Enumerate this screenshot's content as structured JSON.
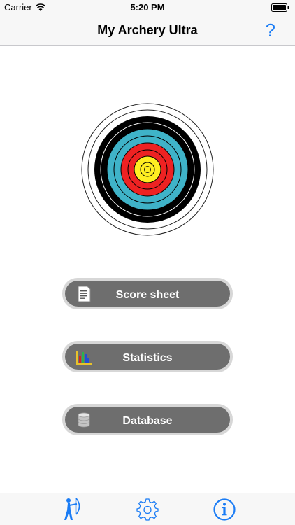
{
  "status_bar": {
    "carrier": "Carrier",
    "time": "5:20 PM"
  },
  "nav": {
    "title": "My Archery Ultra",
    "help_label": "?"
  },
  "menu": [
    {
      "label": "Score sheet",
      "icon": "document-icon"
    },
    {
      "label": "Statistics",
      "icon": "bar-chart-icon"
    },
    {
      "label": "Database",
      "icon": "database-icon"
    }
  ],
  "tabs": [
    {
      "icon": "archer-icon",
      "selected": true
    },
    {
      "icon": "gear-icon",
      "selected": false
    },
    {
      "icon": "info-icon",
      "selected": false
    }
  ],
  "colors": {
    "accent": "#1a7cf5",
    "button_bg": "#6e6e6e",
    "button_rim": "#d7d7d7"
  }
}
